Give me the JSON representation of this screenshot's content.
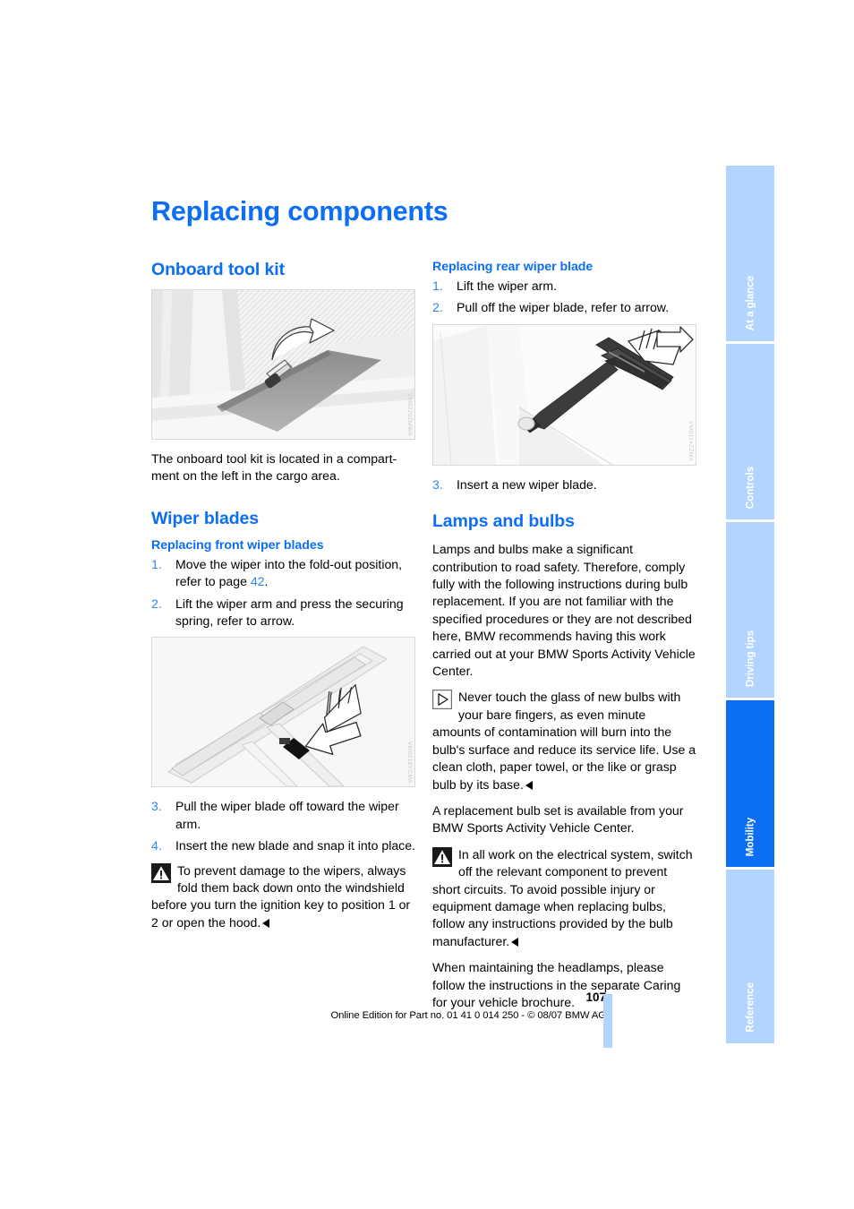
{
  "page": {
    "title": "Replacing components",
    "number": "107",
    "footer_line": "Online Edition for Part no. 01 41 0 014 250 - © 08/07 BMW AG",
    "accent_color": "#0c6ef4",
    "tab_inactive_color": "#b3d4ff"
  },
  "tabs": [
    {
      "label": "At a glance",
      "active": false
    },
    {
      "label": "Controls",
      "active": false
    },
    {
      "label": "Driving tips",
      "active": false
    },
    {
      "label": "Mobility",
      "active": true
    },
    {
      "label": "Reference",
      "active": false
    }
  ],
  "left_column": {
    "section_toolkit": {
      "heading": "Onboard tool kit",
      "figure_code": "VM0220ZMWA",
      "body": "The onboard tool kit is located in a compart-ment on the left in the cargo area."
    },
    "section_wiper": {
      "heading": "Wiper blades",
      "subheading": "Replacing front wiper blades",
      "steps": [
        {
          "num": "1.",
          "text_before": "Move the wiper into the fold-out position, refer to page ",
          "pageref": "42",
          "text_after": "."
        },
        {
          "num": "2.",
          "text_before": "Lift the wiper arm and press the securing spring, refer to arrow.",
          "pageref": "",
          "text_after": ""
        }
      ],
      "figure_code": "VM0218YCMA",
      "steps2": [
        {
          "num": "3.",
          "text_before": "Pull the wiper blade off toward the wiper arm.",
          "pageref": "",
          "text_after": ""
        },
        {
          "num": "4.",
          "text_before": "Insert the new blade and snap it into place.",
          "pageref": "",
          "text_after": ""
        }
      ],
      "warning": "To prevent damage to the wipers, always fold them back down onto the windshield before you turn the ignition key to position 1 or 2 or open the hood."
    }
  },
  "right_column": {
    "section_rear_wiper": {
      "subheading": "Replacing rear wiper blade",
      "steps": [
        {
          "num": "1.",
          "text": "Lift the wiper arm."
        },
        {
          "num": "2.",
          "text": "Pull off the wiper blade, refer to arrow."
        }
      ],
      "figure_code": "VM0114ZZMA",
      "steps2": [
        {
          "num": "3.",
          "text": "Insert a new wiper blade."
        }
      ]
    },
    "section_lamps": {
      "heading": "Lamps and bulbs",
      "intro": "Lamps and bulbs make a significant contribution to road safety. Therefore, comply fully with the following instructions during bulb replacement. If you are not familiar with the specified procedures or they are not described here, BMW recommends having this work carried out at your BMW Sports Activity Vehicle Center.",
      "note": "Never touch the glass of new bulbs with your bare fingers, as even minute amounts of contamination will burn into the bulb's surface and reduce its service life. Use a clean cloth, paper towel, or the like or grasp bulb by its base.",
      "replacement_note": "A replacement bulb set is available from your BMW Sports Activity Vehicle Center.",
      "warning": "In all work on the electrical system, switch off the relevant component to prevent short circuits. To avoid possible injury or equipment damage when replacing bulbs, follow any instructions provided by the bulb manufacturer.",
      "closing": "When maintaining the headlamps, please follow the instructions in the separate Caring for your vehicle brochure."
    }
  }
}
